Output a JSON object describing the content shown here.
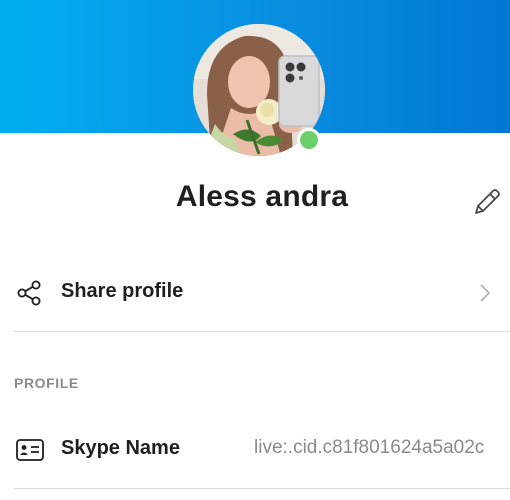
{
  "profile": {
    "display_name": "Aless andra",
    "presence_status": "online",
    "presence_color": "#6bd06b"
  },
  "theme": {
    "header_gradient_start": "#00aff0",
    "header_gradient_end": "#0078d4",
    "text_primary": "#1f1f1f",
    "text_secondary": "#8a8a8a"
  },
  "actions": {
    "edit_icon": "pencil-icon",
    "share_label": "Share profile",
    "share_icon": "share-icon",
    "share_chevron_icon": "chevron-right-icon"
  },
  "sections": {
    "profile_header": "PROFILE"
  },
  "fields": {
    "skype_name_label": "Skype Name",
    "skype_name_value": "live:.cid.c81f801624a5a02c",
    "skype_name_icon": "id-card-icon"
  }
}
